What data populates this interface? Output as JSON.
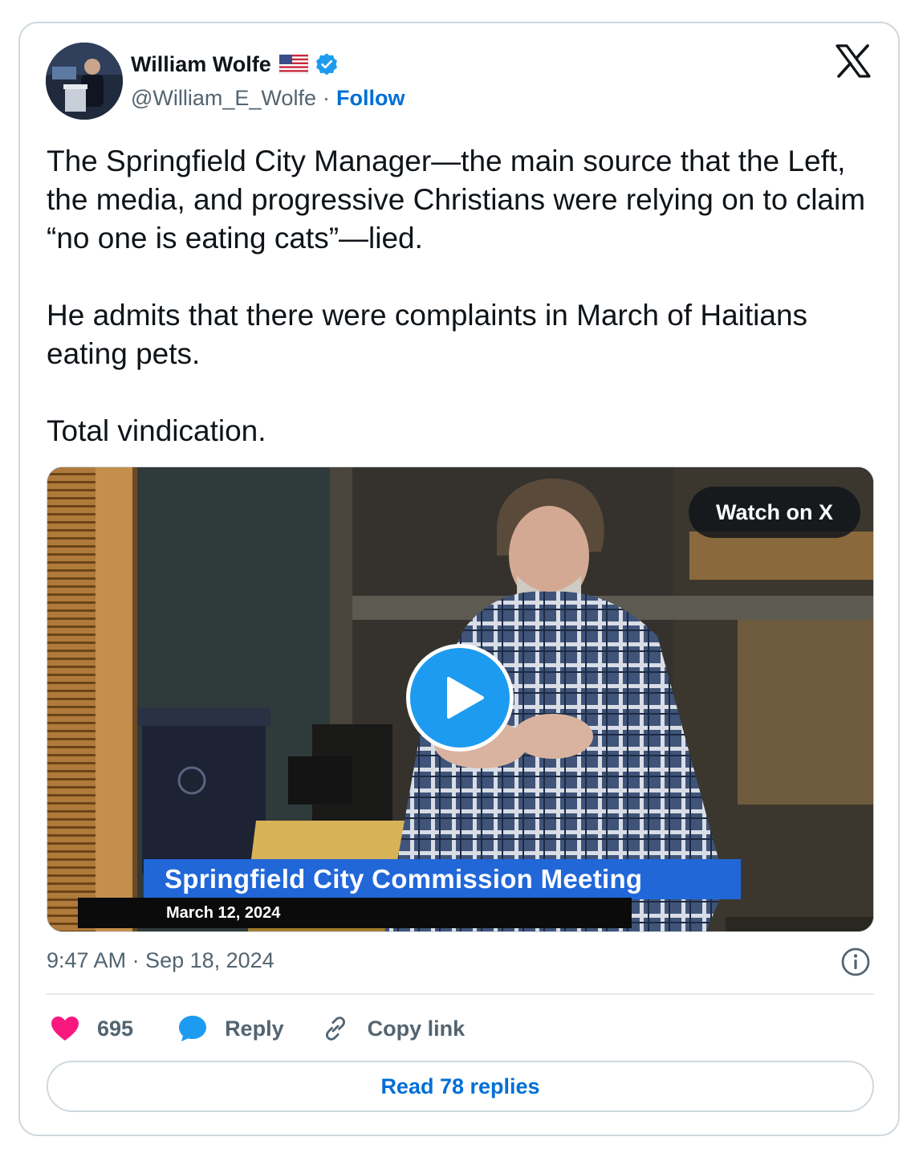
{
  "author": {
    "name": "William Wolfe",
    "handle": "@William_E_Wolfe",
    "separator": "·",
    "follow_label": "Follow",
    "flag_icon": "us-flag-icon",
    "verified_icon": "verified-badge-icon"
  },
  "tweet": {
    "text": "The Springfield City Manager—the main source that the Left, the media, and progressive Christians were relying on to claim “no one is eating cats”—lied.\n\nHe admits that there were complaints in March of Haitians eating pets.\n\nTotal vindication."
  },
  "media": {
    "watch_label": "Watch on X",
    "caption_title": "Springfield City Commission Meeting",
    "caption_date": "March 12, 2024"
  },
  "meta": {
    "timestamp": "9:47 AM · Sep 18, 2024"
  },
  "actions": {
    "like_count": "695",
    "reply_label": "Reply",
    "copy_label": "Copy link"
  },
  "footer": {
    "read_replies_label": "Read 78 replies"
  },
  "colors": {
    "link_blue": "#006fd6",
    "verified_blue": "#1d9bf0",
    "like_pink": "#f91880",
    "muted_text": "#536471",
    "border": "#cfd9de"
  }
}
